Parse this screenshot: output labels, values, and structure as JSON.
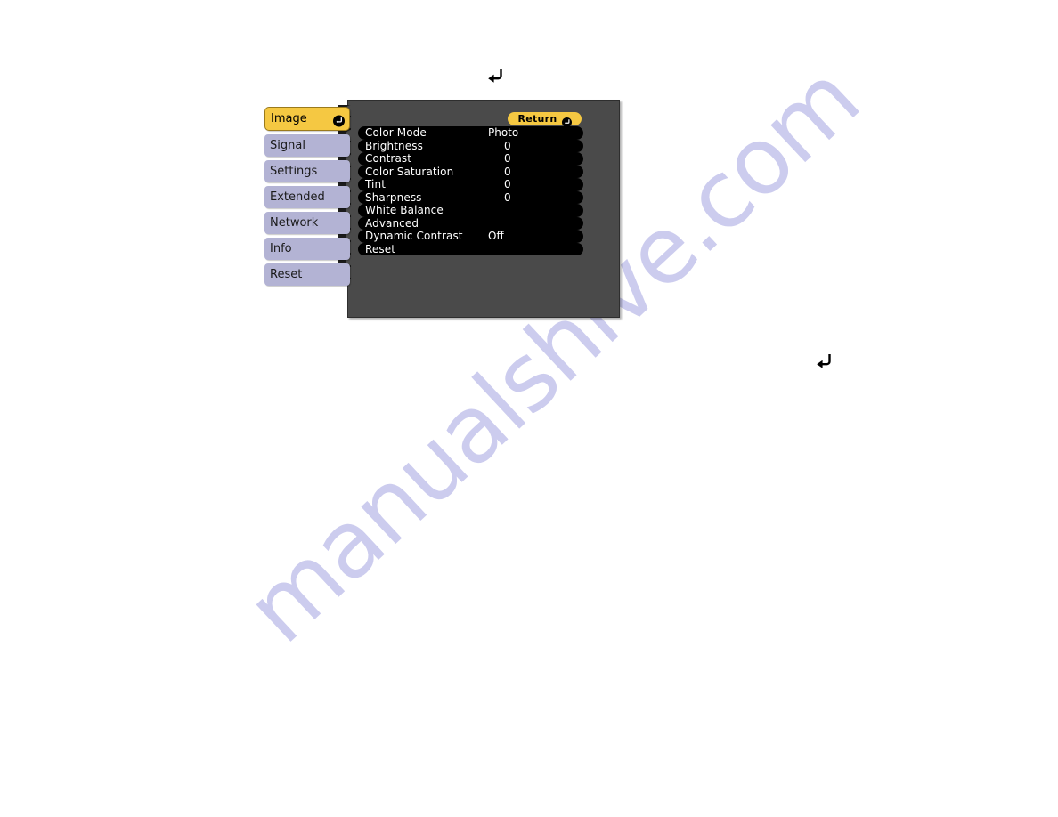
{
  "watermark": {
    "text": "manualshive.com",
    "color": "#ccccee"
  },
  "colors": {
    "selected_tab": "#f5c842",
    "tab": "#b3b3d4",
    "panel": "#4a4a4a",
    "row": "#000000",
    "text_light": "#ffffff",
    "text_dark": "#1a1a1a"
  },
  "osd": {
    "sidebar": {
      "items": [
        {
          "label": "Image",
          "selected": true,
          "icon": "enter-icon"
        },
        {
          "label": "Signal",
          "selected": false
        },
        {
          "label": "Settings",
          "selected": false
        },
        {
          "label": "Extended",
          "selected": false
        },
        {
          "label": "Network",
          "selected": false
        },
        {
          "label": "Info",
          "selected": false
        },
        {
          "label": "Reset",
          "selected": false
        }
      ]
    },
    "return_button": {
      "label": "Return",
      "icon": "enter-icon"
    },
    "options": [
      {
        "label": "Color Mode",
        "value": "Photo",
        "value_type": "text"
      },
      {
        "label": "Brightness",
        "value": "0",
        "value_type": "num"
      },
      {
        "label": "Contrast",
        "value": "0",
        "value_type": "num"
      },
      {
        "label": "Color Saturation",
        "value": "0",
        "value_type": "num"
      },
      {
        "label": "Tint",
        "value": "0",
        "value_type": "num"
      },
      {
        "label": "Sharpness",
        "value": "0",
        "value_type": "num"
      },
      {
        "label": "White Balance",
        "value": "",
        "value_type": "text"
      },
      {
        "label": "Advanced",
        "value": "",
        "value_type": "text"
      },
      {
        "label": "Dynamic Contrast",
        "value": "Off",
        "value_type": "text"
      },
      {
        "label": "Reset",
        "value": "",
        "value_type": "text"
      }
    ],
    "loose_icons": [
      {
        "name": "enter-icon-top"
      },
      {
        "name": "enter-icon-right"
      }
    ]
  }
}
